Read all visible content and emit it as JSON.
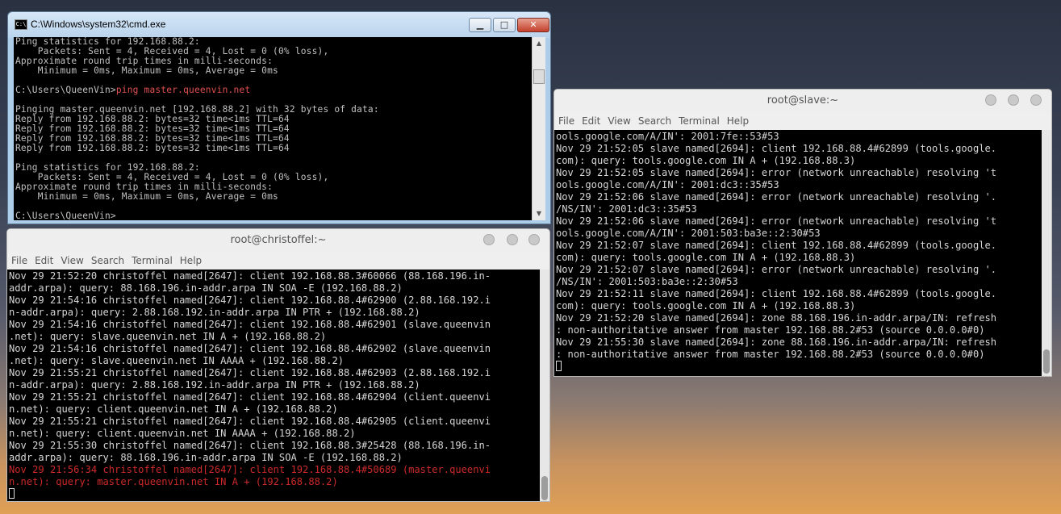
{
  "cmd": {
    "title": "C:\\Windows\\system32\\cmd.exe",
    "icon": "C:\\",
    "buttons": {
      "minimize": "▁",
      "maximize": "□",
      "close": "✕"
    },
    "lines_before": "Ping statistics for 192.168.88.2:\n    Packets: Sent = 4, Received = 4, Lost = 0 (0% loss),\nApproximate round trip times in milli-seconds:\n    Minimum = 0ms, Maximum = 0ms, Average = 0ms\n\nC:\\Users\\QueenVin>",
    "command": "ping master.queenvin.net",
    "lines_after": "\n\nPinging master.queenvin.net [192.168.88.2] with 32 bytes of data:\nReply from 192.168.88.2: bytes=32 time<1ms TTL=64\nReply from 192.168.88.2: bytes=32 time<1ms TTL=64\nReply from 192.168.88.2: bytes=32 time<1ms TTL=64\nReply from 192.168.88.2: bytes=32 time<1ms TTL=64\n\nPing statistics for 192.168.88.2:\n    Packets: Sent = 4, Received = 4, Lost = 0 (0% loss),\nApproximate round trip times in milli-seconds:\n    Minimum = 0ms, Maximum = 0ms, Average = 0ms\n\nC:\\Users\\QueenVin>_"
  },
  "term_christoffel": {
    "title": "root@christoffel:~",
    "menu": [
      "File",
      "Edit",
      "View",
      "Search",
      "Terminal",
      "Help"
    ],
    "log_normal": "Nov 29 21:52:20 christoffel named[2647]: client 192.168.88.3#60066 (88.168.196.in-\naddr.arpa): query: 88.168.196.in-addr.arpa IN SOA -E (192.168.88.2)\nNov 29 21:54:16 christoffel named[2647]: client 192.168.88.4#62900 (2.88.168.192.i\nn-addr.arpa): query: 2.88.168.192.in-addr.arpa IN PTR + (192.168.88.2)\nNov 29 21:54:16 christoffel named[2647]: client 192.168.88.4#62901 (slave.queenvin\n.net): query: slave.queenvin.net IN A + (192.168.88.2)\nNov 29 21:54:16 christoffel named[2647]: client 192.168.88.4#62902 (slave.queenvin\n.net): query: slave.queenvin.net IN AAAA + (192.168.88.2)\nNov 29 21:55:21 christoffel named[2647]: client 192.168.88.4#62903 (2.88.168.192.i\nn-addr.arpa): query: 2.88.168.192.in-addr.arpa IN PTR + (192.168.88.2)\nNov 29 21:55:21 christoffel named[2647]: client 192.168.88.4#62904 (client.queenvi\nn.net): query: client.queenvin.net IN A + (192.168.88.2)\nNov 29 21:55:21 christoffel named[2647]: client 192.168.88.4#62905 (client.queenvi\nn.net): query: client.queenvin.net IN AAAA + (192.168.88.2)\nNov 29 21:55:30 christoffel named[2647]: client 192.168.88.3#25428 (88.168.196.in-\naddr.arpa): query: 88.168.196.in-addr.arpa IN SOA -E (192.168.88.2)",
    "log_highlight": "Nov 29 21:56:34 christoffel named[2647]: client 192.168.88.4#50689 (master.queenvi\nn.net): query: master.queenvin.net IN A + (192.168.88.2)",
    "scroll_position": 0.95
  },
  "term_slave": {
    "title": "root@slave:~",
    "menu": [
      "File",
      "Edit",
      "View",
      "Search",
      "Terminal",
      "Help"
    ],
    "log": "ools.google.com/A/IN': 2001:7fe::53#53\nNov 29 21:52:05 slave named[2694]: client 192.168.88.4#62899 (tools.google.\ncom): query: tools.google.com IN A + (192.168.88.3)\nNov 29 21:52:05 slave named[2694]: error (network unreachable) resolving 't\nools.google.com/A/IN': 2001:dc3::35#53\nNov 29 21:52:06 slave named[2694]: error (network unreachable) resolving '.\n/NS/IN': 2001:dc3::35#53\nNov 29 21:52:06 slave named[2694]: error (network unreachable) resolving 't\nools.google.com/A/IN': 2001:503:ba3e::2:30#53\nNov 29 21:52:07 slave named[2694]: client 192.168.88.4#62899 (tools.google.\ncom): query: tools.google.com IN A + (192.168.88.3)\nNov 29 21:52:07 slave named[2694]: error (network unreachable) resolving '.\n/NS/IN': 2001:503:ba3e::2:30#53\nNov 29 21:52:11 slave named[2694]: client 192.168.88.4#62899 (tools.google.\ncom): query: tools.google.com IN A + (192.168.88.3)\nNov 29 21:52:20 slave named[2694]: zone 88.168.196.in-addr.arpa/IN: refresh\n: non-authoritative answer from master 192.168.88.2#53 (source 0.0.0.0#0)\nNov 29 21:55:30 slave named[2694]: zone 88.168.196.in-addr.arpa/IN: refresh\n: non-authoritative answer from master 192.168.88.2#53 (source 0.0.0.0#0)",
    "scroll_position": 0.95
  }
}
